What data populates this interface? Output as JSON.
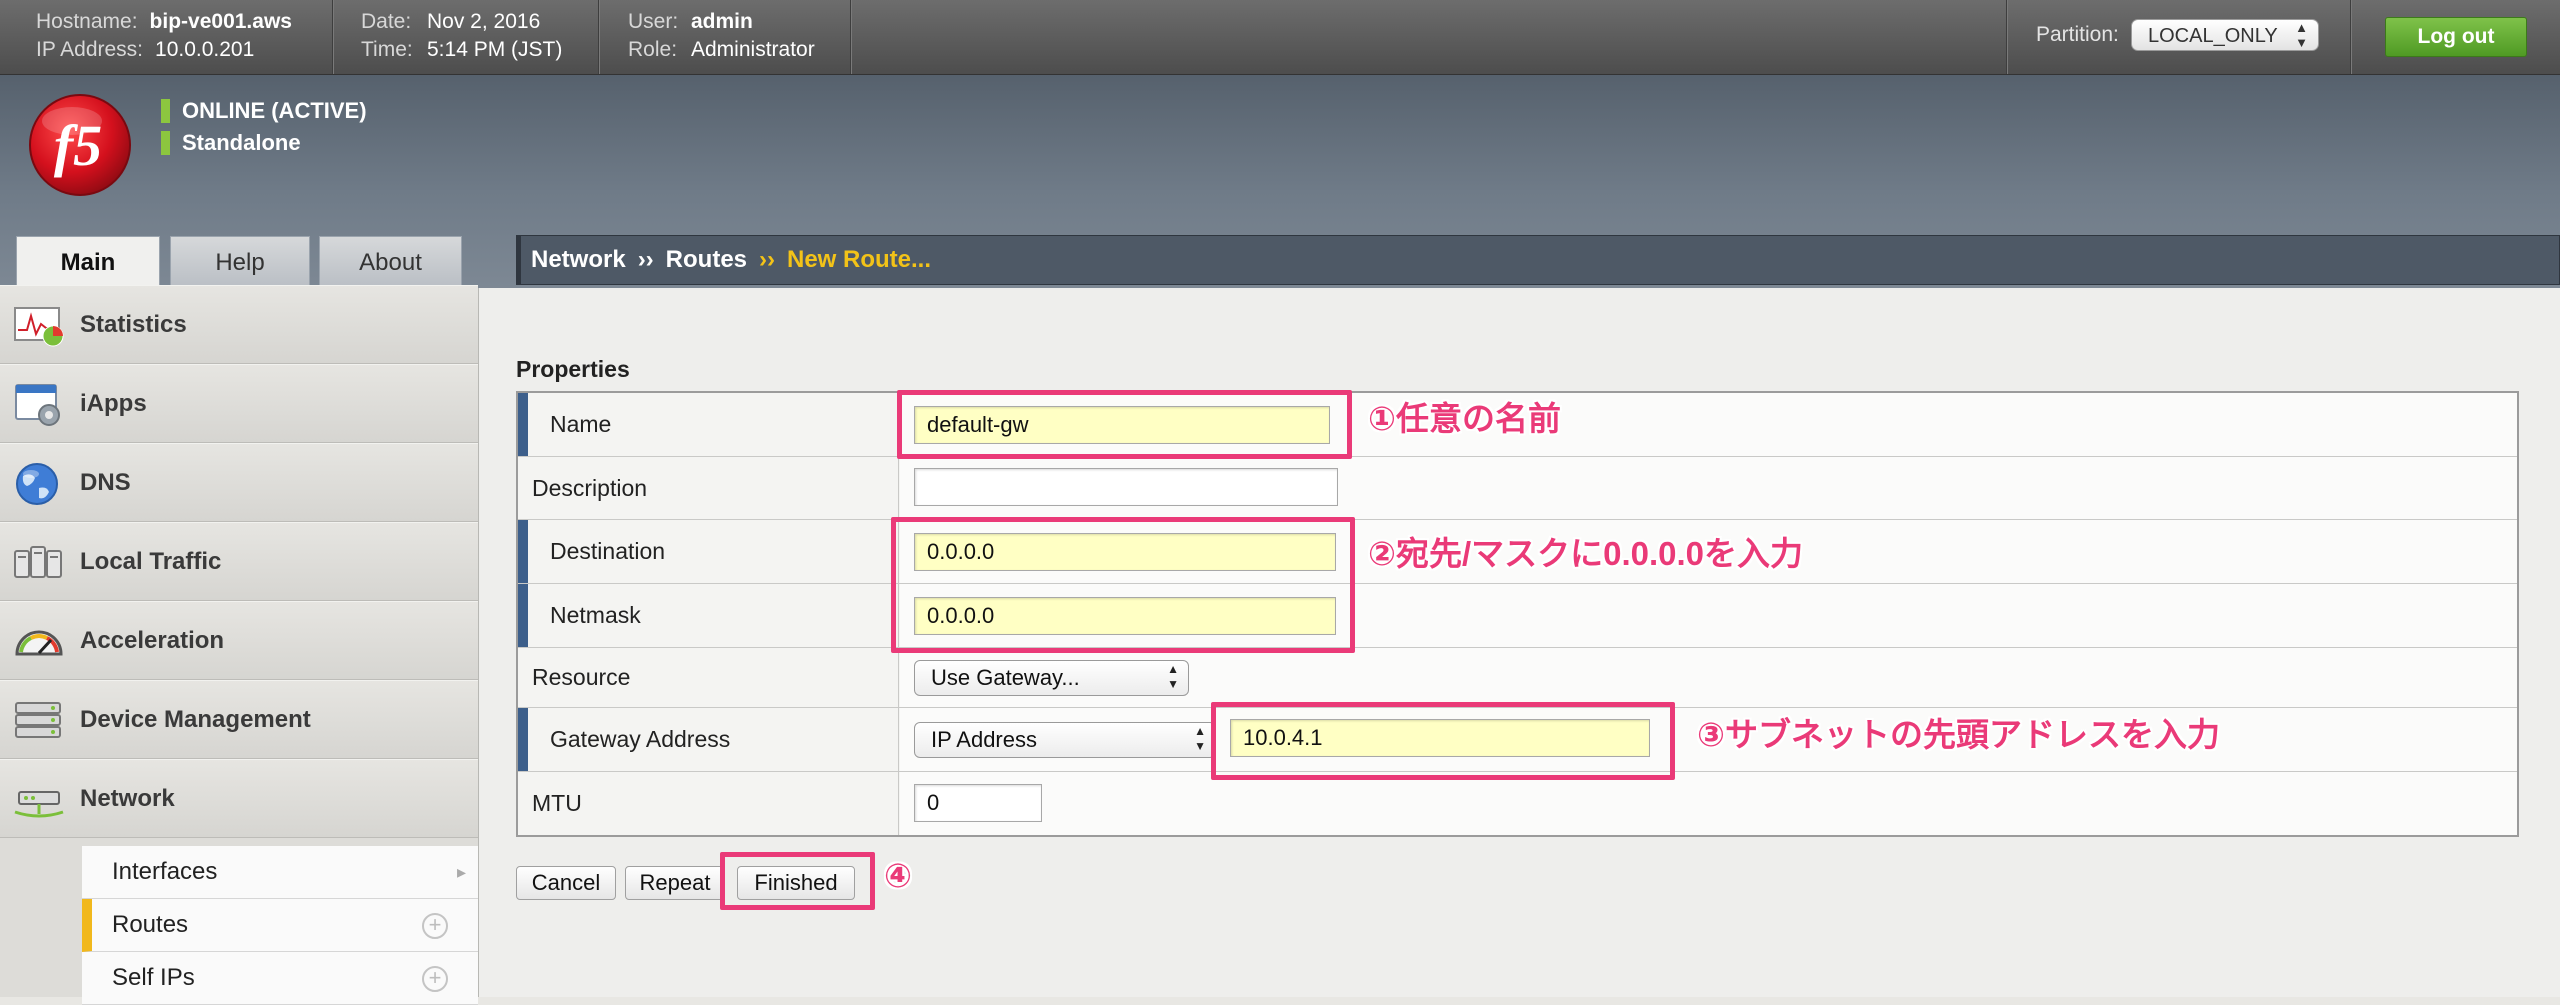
{
  "topbar": {
    "hostname_label": "Hostname:",
    "hostname": "bip-ve001.aws",
    "ip_label": "IP Address:",
    "ip": "10.0.0.201",
    "date_label": "Date:",
    "date": "Nov 2, 2016",
    "time_label": "Time:",
    "time": "5:14 PM (JST)",
    "user_label": "User:",
    "user": "admin",
    "role_label": "Role:",
    "role": "Administrator",
    "partition_label": "Partition:",
    "partition_value": "LOCAL_ONLY",
    "logout_label": "Log out"
  },
  "header": {
    "logo_text": "f5",
    "status_online": "ONLINE (ACTIVE)",
    "status_mode": "Standalone"
  },
  "tabs": [
    {
      "label": "Main",
      "active": true
    },
    {
      "label": "Help",
      "active": false
    },
    {
      "label": "About",
      "active": false
    }
  ],
  "breadcrumb": {
    "items": [
      "Network",
      "Routes"
    ],
    "current": "New Route...",
    "separator": "››"
  },
  "sidebar": {
    "items": [
      {
        "label": "Statistics",
        "icon": "statistics-icon"
      },
      {
        "label": "iApps",
        "icon": "iapps-icon"
      },
      {
        "label": "DNS",
        "icon": "globe-icon"
      },
      {
        "label": "Local Traffic",
        "icon": "local-traffic-icon"
      },
      {
        "label": "Acceleration",
        "icon": "gauge-icon"
      },
      {
        "label": "Device Management",
        "icon": "device-management-icon"
      },
      {
        "label": "Network",
        "icon": "network-icon"
      }
    ],
    "subitems": [
      {
        "label": "Interfaces",
        "selected": false
      },
      {
        "label": "Routes",
        "selected": true
      },
      {
        "label": "Self IPs",
        "selected": false
      }
    ]
  },
  "form": {
    "section_title": "Properties",
    "name_label": "Name",
    "name_value": "default-gw",
    "description_label": "Description",
    "description_value": "",
    "destination_label": "Destination",
    "destination_value": "0.0.0.0",
    "netmask_label": "Netmask",
    "netmask_value": "0.0.0.0",
    "resource_label": "Resource",
    "resource_value": "Use Gateway...",
    "gateway_label": "Gateway Address",
    "gateway_type": "IP Address",
    "gateway_value": "10.0.4.1",
    "mtu_label": "MTU",
    "mtu_value": "0"
  },
  "buttons": {
    "cancel": "Cancel",
    "repeat": "Repeat",
    "finished": "Finished"
  },
  "annotations": {
    "note1": "①任意の名前",
    "note2": "②宛先/マスクに0.0.0.0を入力",
    "note3": "③サブネットの先頭アドレスを入力",
    "note4": "④"
  },
  "colors": {
    "highlight": "#ea3a78",
    "required_bar": "#3d5f8b",
    "status_green": "#8cc63f",
    "breadcrumb_current": "#f3c318",
    "logout_green": "#5aa52c"
  }
}
